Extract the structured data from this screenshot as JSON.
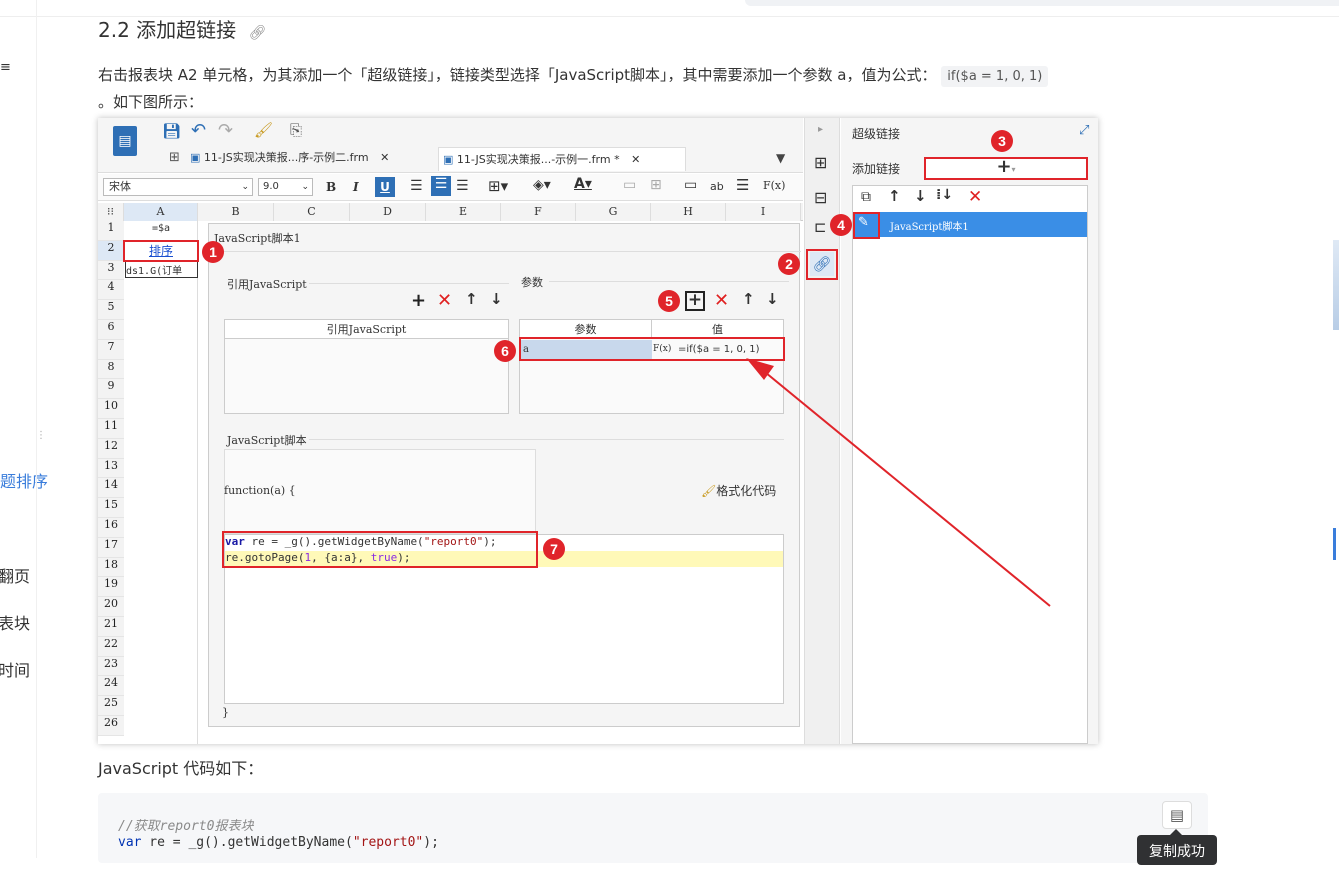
{
  "article": {
    "heading": "2.2 添加超链接",
    "link_icon": "link-icon",
    "paragraph": "右击报表块 A2 单元格，为其添加一个「超级链接」，链接类型选择「JavaScript脚本」，其中需要添加一个参数 a，值为公式：",
    "formula_code": "if($a = 1, 0, 1)",
    "paragraph_end": "。如下图所示：",
    "code_intro": "JavaScript 代码如下：",
    "code_comment": "//获取report0报表块",
    "code_line1_kw": "var",
    "code_line1_rest": "  re  =  _g().getWidgetByName(",
    "code_line1_str": "\"report0\"",
    "code_line1_end": ");",
    "copy_tooltip": "复制成功"
  },
  "left_nav": {
    "items": [
      "题排序",
      "翻页",
      "表块",
      "时间"
    ]
  },
  "designer": {
    "tabs": [
      "11-JS实现决策报...序-示例二.frm",
      "11-JS实现决策报...-示例一.frm *"
    ],
    "font_name": "宋体",
    "font_size": "9.0",
    "columns": [
      "A",
      "B",
      "C",
      "D",
      "E",
      "F",
      "G",
      "H",
      "I"
    ],
    "rows": [
      "1",
      "2",
      "3",
      "4",
      "5",
      "6",
      "7",
      "8",
      "9",
      "10",
      "11",
      "12",
      "13",
      "14",
      "15",
      "16",
      "17",
      "18",
      "19",
      "20",
      "21",
      "22",
      "23",
      "24",
      "25",
      "26"
    ],
    "cells": {
      "a1": "=$a",
      "a2": "排序",
      "a3": "ds1.G(订单"
    },
    "dialog": {
      "title": "JavaScript脚本1",
      "ref_js_section": "引用JavaScript",
      "params_section": "参数",
      "ref_js_col": "引用JavaScript",
      "param_col": "参数",
      "value_col": "值",
      "param_name": "a",
      "param_value": "=if($a = 1, 0, 1)",
      "fx": "F(x)",
      "script_section": "JavaScript脚本",
      "func_header": "function(a) {",
      "format_btn": "格式化代码",
      "code_line1": "var re = _g().getWidgetByName(\"report0\");",
      "code_line2": "re.gotoPage(1, {a:a}, true);",
      "func_end": "}"
    },
    "right_panel": {
      "title": "超级链接",
      "add_link": "添加链接",
      "item": "JavaScript脚本1"
    },
    "badges": [
      "1",
      "2",
      "3",
      "4",
      "5",
      "6",
      "7"
    ]
  }
}
